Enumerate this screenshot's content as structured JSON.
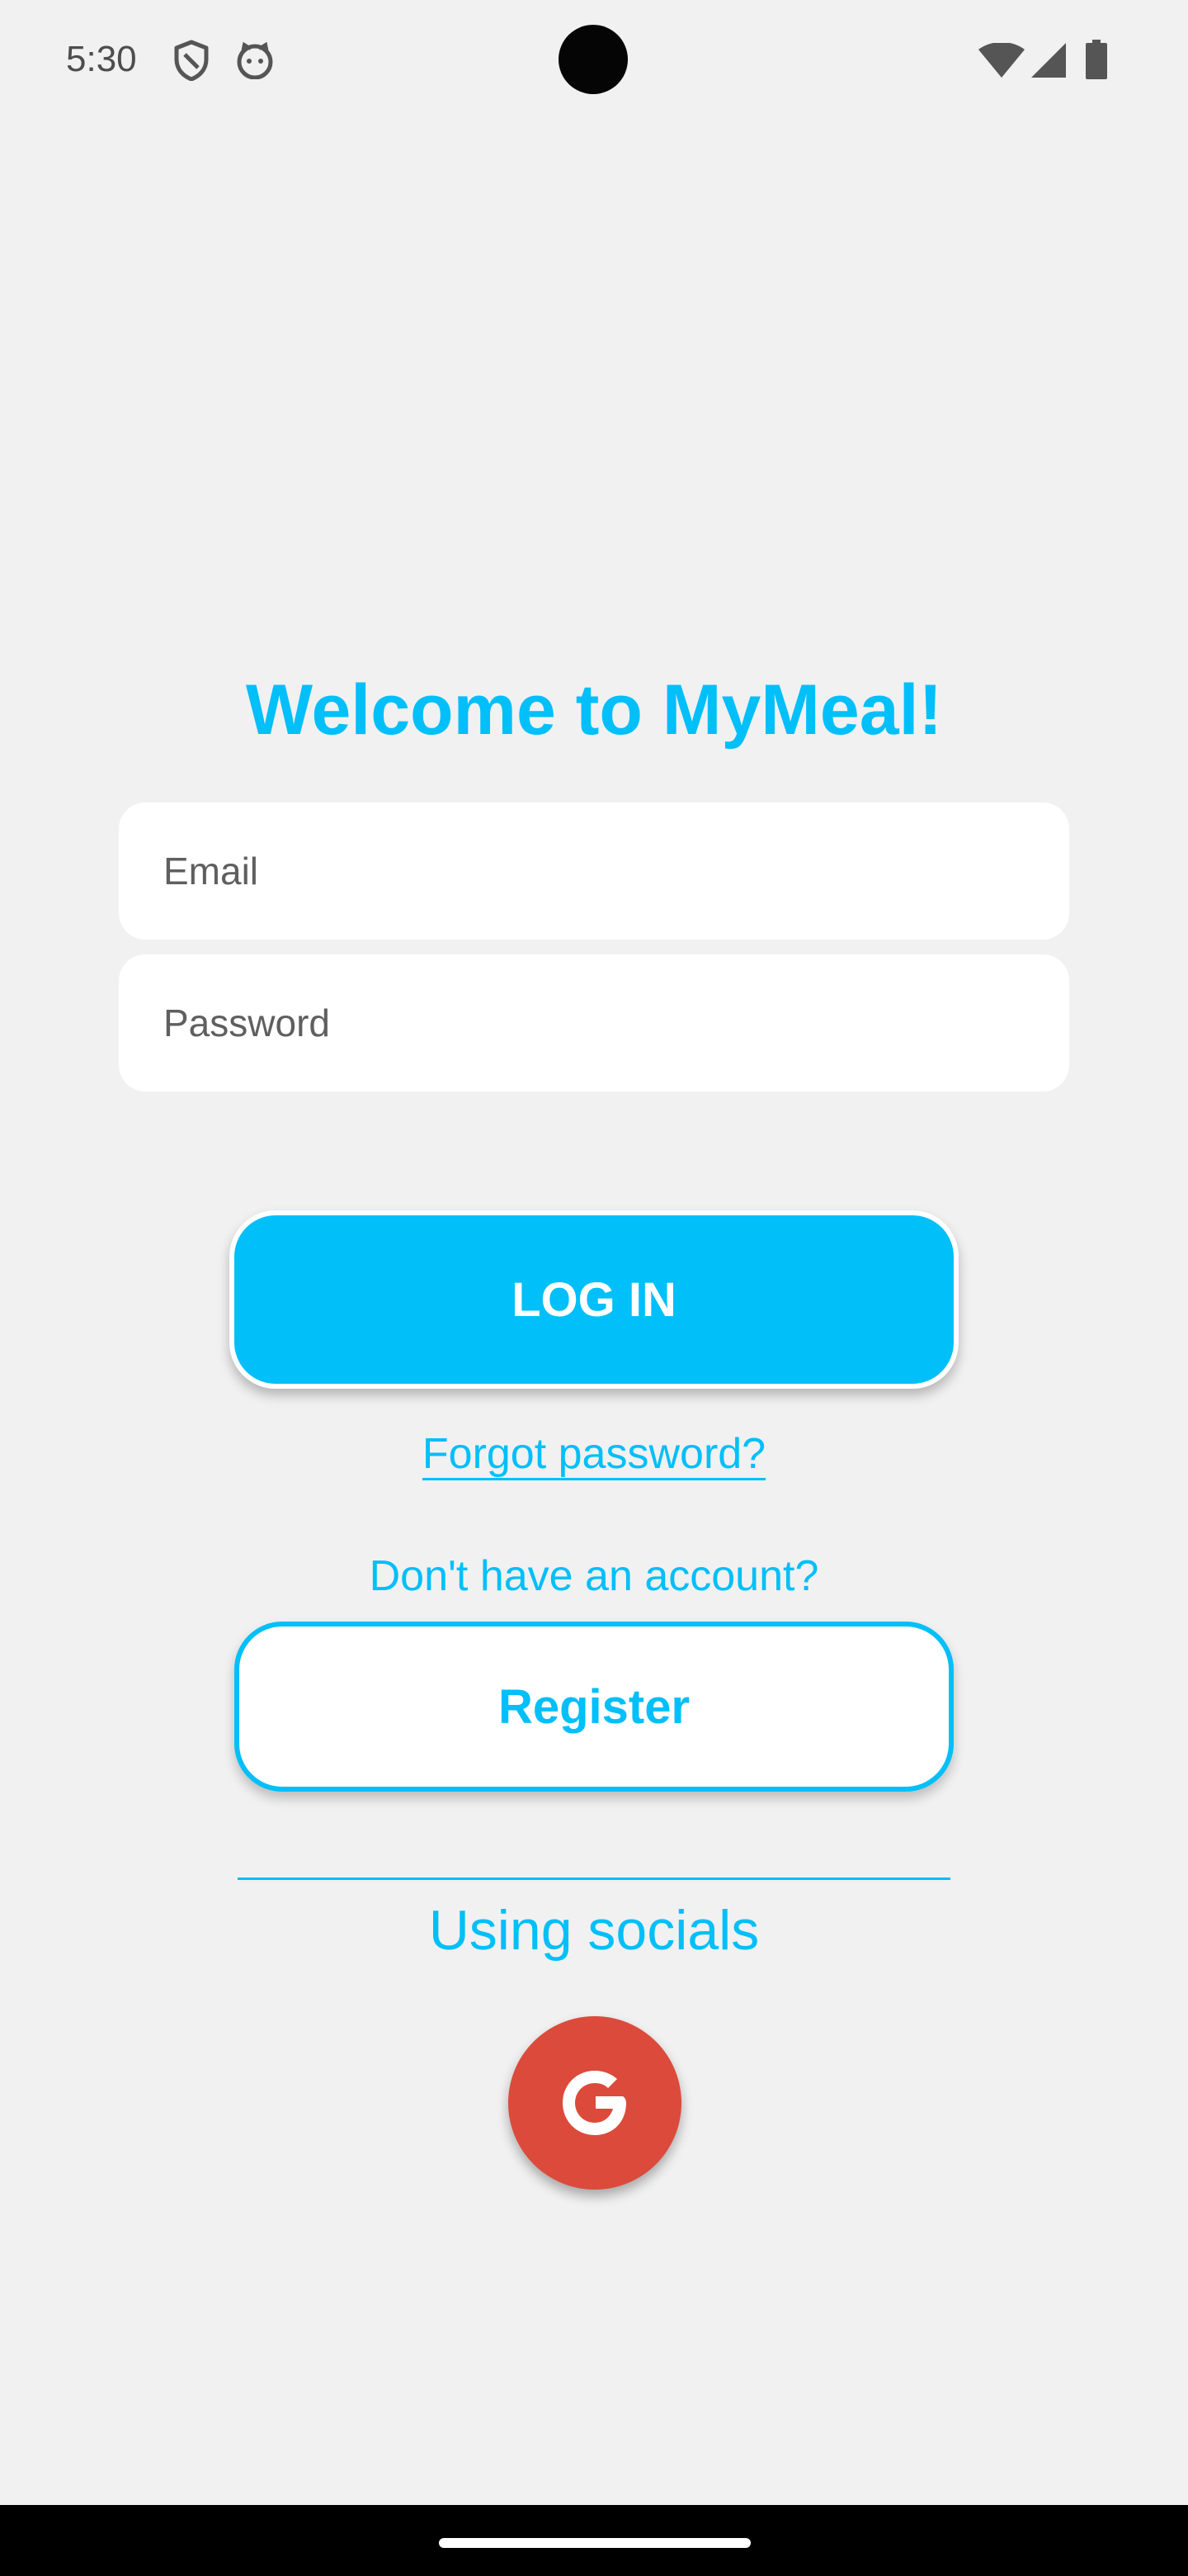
{
  "status_bar": {
    "time": "5:30",
    "icons": [
      "shield-icon",
      "cat-icon",
      "wifi-icon",
      "signal-icon",
      "battery-icon"
    ]
  },
  "login": {
    "title": "Welcome to MyMeal!",
    "email_placeholder": "Email",
    "email_value": "",
    "password_placeholder": "Password",
    "password_value": "",
    "login_button": "LOG IN",
    "forgot_password": "Forgot password?",
    "no_account": "Don't have an account?",
    "register_button": "Register",
    "socials_label": "Using socials",
    "google_icon": "google-icon"
  },
  "colors": {
    "accent": "#00bff9",
    "background": "#f1f1f1",
    "field_background": "#ffffff",
    "google_red": "#dc4a3b",
    "nav_bar": "#000000"
  }
}
